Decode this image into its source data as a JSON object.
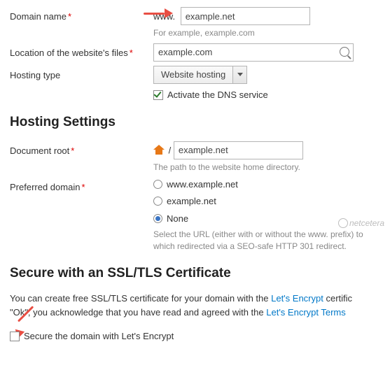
{
  "domain": {
    "label": "Domain name",
    "www": "www.",
    "value": "example.net",
    "hint": "For example, example.com"
  },
  "location": {
    "label": "Location of the website's files",
    "value": "example.com"
  },
  "hosting_type": {
    "label": "Hosting type",
    "value": "Website hosting"
  },
  "dns": {
    "label": "Activate the DNS service",
    "checked": true
  },
  "hosting_settings_heading": "Hosting Settings",
  "docroot": {
    "label": "Document root",
    "separator": "/",
    "value": "example.net",
    "hint": "The path to the website home directory."
  },
  "preferred": {
    "label": "Preferred domain",
    "options": [
      "www.example.net",
      "example.net",
      "None"
    ],
    "selected": "None",
    "hint": "Select the URL (either with or without the www. prefix) to which redirected via a SEO-safe HTTP 301 redirect."
  },
  "ssl": {
    "heading": "Secure with an SSL/TLS Certificate",
    "para_1a": "You can create free SSL/TLS certificate for your domain with the ",
    "link1": "Let's Encrypt",
    "para_1b": " certific",
    "para_2a": "\"Ok\", you acknowledge that you have read and agreed with the ",
    "link2": "Let's Encrypt Terms ",
    "checkbox_label": "Secure the domain with Let's Encrypt",
    "checked": false
  },
  "watermark": "netcetera"
}
